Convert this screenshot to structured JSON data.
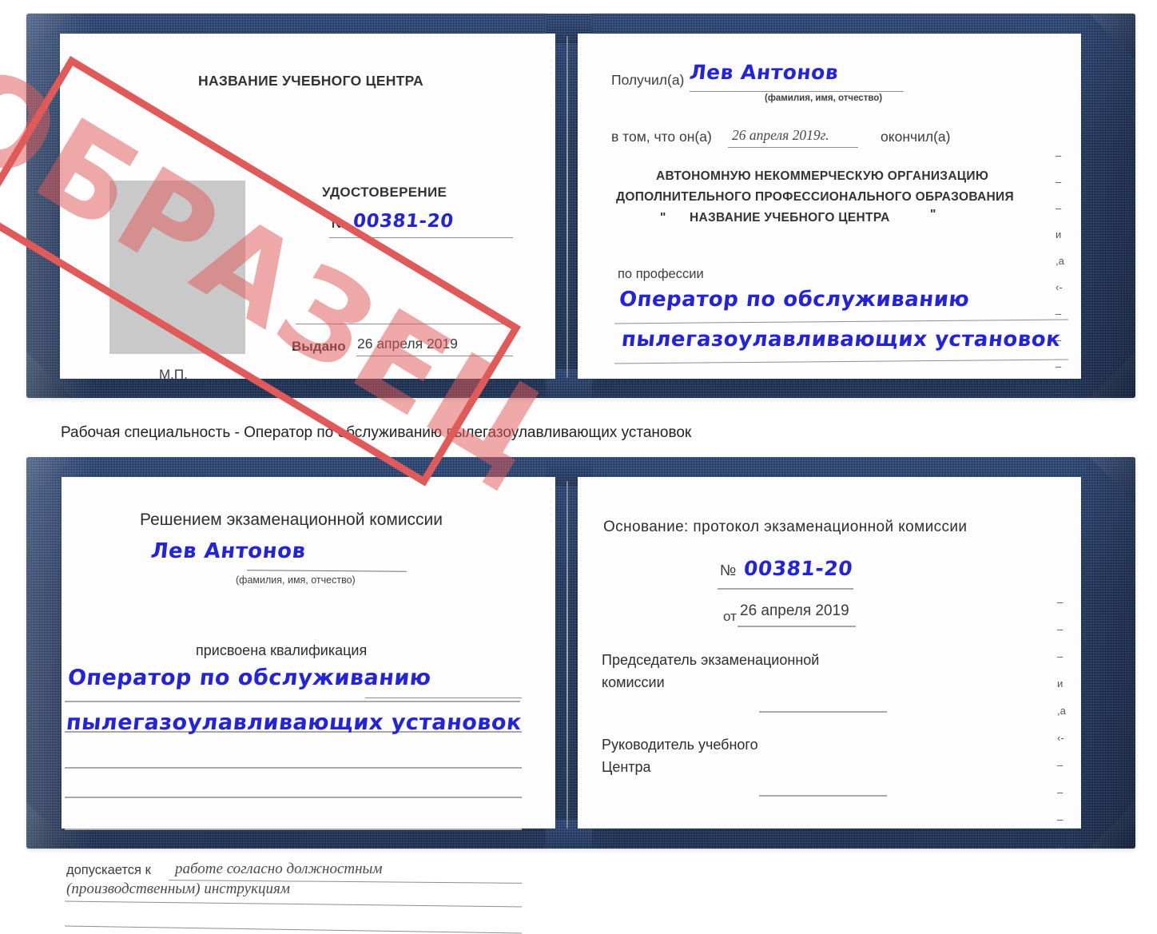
{
  "caption": "Рабочая специальность - Оператор по обслуживанию пылегазоулавливающих установок",
  "watermark": {
    "text": "ОБРАЗЕЦ",
    "color": "#e05a5a"
  },
  "colors": {
    "cover_navy": "#1f3e75",
    "handwriting_blue": "#2323dd",
    "stamp_red": "#e05a5a",
    "photo_placeholder": "#c9c9c9",
    "rule_gray": "#a8a8a8"
  },
  "certificate_top": {
    "left_page": {
      "org_title": "НАЗВАНИЕ УЧЕБНОГО ЦЕНТРА",
      "doc_type": "УДОСТОВЕРЕНИЕ",
      "number_label": "№",
      "number_value": "00381-20",
      "issued_label": "Выдано",
      "issued_value": "26 апреля 2019",
      "seal_label": "М.П."
    },
    "right_page": {
      "received_label": "Получил(а)",
      "received_value": "Лев Антонов",
      "name_hint": "(фамилия, имя, отчество)",
      "statement_prefix": "в том, что он(а)",
      "statement_date": "26 апреля 2019г.",
      "statement_suffix": "окончил(а)",
      "org_line1": "АВТОНОМНУЮ НЕКОММЕРЧЕСКУЮ ОРГАНИЗАЦИЮ",
      "org_line2": "ДОПОЛНИТЕЛЬНОГО ПРОФЕССИОНАЛЬНОГО ОБРАЗОВАНИЯ",
      "org_quote_open": "\"",
      "org_line3": "НАЗВАНИЕ УЧЕБНОГО ЦЕНТРА",
      "org_quote_close": "\"",
      "profession_label": "по профессии",
      "profession_line1": "Оператор по обслуживанию",
      "profession_line2": "пылегазоулавливающих установок",
      "edge_marks": [
        "–",
        "–",
        "–",
        "и",
        ",а",
        "‹-",
        "–",
        "–",
        "–",
        "–"
      ]
    }
  },
  "certificate_bottom": {
    "left_page": {
      "heading": "Решением экзаменационной комиссии",
      "name_value": "Лев Антонов",
      "name_hint": "(фамилия, имя, отчество)",
      "qualification_label": "присвоена квалификация",
      "qualification_line1": "Оператор по обслуживанию",
      "qualification_line2": "пылегазоулавливающих установок",
      "admitted_label": "допускается к",
      "admitted_line1": "работе согласно должностным",
      "admitted_line2": "(производственным) инструкциям"
    },
    "right_page": {
      "basis_label": "Основание: протокол экзаменационной комиссии",
      "number_label": "№",
      "number_value": "00381-20",
      "date_label": "от",
      "date_value": "26 апреля 2019",
      "chairman_line1": "Председатель экзаменационной",
      "chairman_line2": "комиссии",
      "head_line1": "Руководитель учебного",
      "head_line2": "Центра",
      "edge_marks": [
        "–",
        "–",
        "–",
        "и",
        ",а",
        "‹-",
        "–",
        "–",
        "–",
        "–"
      ]
    }
  }
}
